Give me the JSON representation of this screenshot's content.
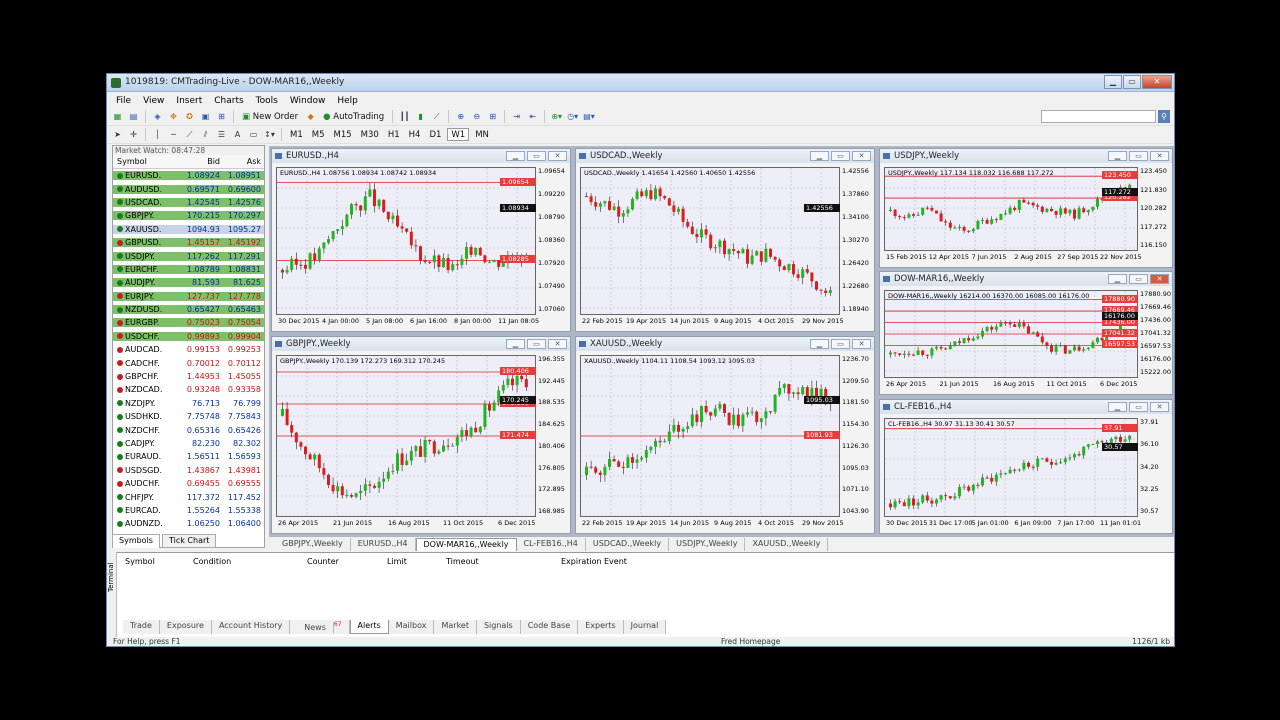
{
  "window": {
    "title": "1019819: CMTrading-Live - DOW-MAR16,,Weekly",
    "min": "▁",
    "max": "▭",
    "close": "✕"
  },
  "menu": [
    "File",
    "View",
    "Insert",
    "Charts",
    "Tools",
    "Window",
    "Help"
  ],
  "toolbar": {
    "new_order": "New Order",
    "autotrading": "AutoTrading",
    "timeframes": [
      "M1",
      "M5",
      "M15",
      "M30",
      "H1",
      "H4",
      "D1",
      "W1",
      "MN"
    ]
  },
  "market_watch": {
    "title": "Market Watch: 08:47:28",
    "headers": [
      "Symbol",
      "Bid",
      "Ask"
    ],
    "rows": [
      {
        "sym": "EURUSD.",
        "bid": "1.08924",
        "ask": "1.08951",
        "style": "g"
      },
      {
        "sym": "AUDUSD.",
        "bid": "0.69571",
        "ask": "0.69600",
        "style": "g"
      },
      {
        "sym": "USDCAD.",
        "bid": "1.42545",
        "ask": "1.42576",
        "style": "g"
      },
      {
        "sym": "GBPJPY.",
        "bid": "170.215",
        "ask": "170.297",
        "style": "g"
      },
      {
        "sym": "XAUUSD.",
        "bid": "1094.93",
        "ask": "1095.27",
        "style": "sel"
      },
      {
        "sym": "GBPUSD.",
        "bid": "1.45157",
        "ask": "1.45192",
        "style": "gr"
      },
      {
        "sym": "USDJPY.",
        "bid": "117.262",
        "ask": "117.291",
        "style": "g"
      },
      {
        "sym": "EURCHF.",
        "bid": "1.08789",
        "ask": "1.08831",
        "style": "g"
      },
      {
        "sym": "AUDJPY.",
        "bid": "81.593",
        "ask": "81.625",
        "style": "g"
      },
      {
        "sym": "EURJPY.",
        "bid": "127.737",
        "ask": "127.778",
        "style": "gr"
      },
      {
        "sym": "NZDUSD.",
        "bid": "0.65427",
        "ask": "0.65463",
        "style": "g"
      },
      {
        "sym": "EURGBP.",
        "bid": "0.75023",
        "ask": "0.75054",
        "style": "gr"
      },
      {
        "sym": "USDCHF.",
        "bid": "0.99893",
        "ask": "0.99904",
        "style": "gr"
      },
      {
        "sym": "AUDCAD.",
        "bid": "0.99153",
        "ask": "0.99253",
        "style": "w"
      },
      {
        "sym": "CADCHF.",
        "bid": "0.70012",
        "ask": "0.70112",
        "style": "w"
      },
      {
        "sym": "GBPCHF.",
        "bid": "1.44953",
        "ask": "1.45055",
        "style": "w"
      },
      {
        "sym": "NZDCAD.",
        "bid": "0.93248",
        "ask": "0.93358",
        "style": "w"
      },
      {
        "sym": "NZDJPY.",
        "bid": "76.713",
        "ask": "76.799",
        "style": "wb"
      },
      {
        "sym": "USDHKD.",
        "bid": "7.75748",
        "ask": "7.75843",
        "style": "wb"
      },
      {
        "sym": "NZDCHF.",
        "bid": "0.65316",
        "ask": "0.65426",
        "style": "wb"
      },
      {
        "sym": "CADJPY.",
        "bid": "82.230",
        "ask": "82.302",
        "style": "wb"
      },
      {
        "sym": "EURAUD.",
        "bid": "1.56511",
        "ask": "1.56593",
        "style": "wb"
      },
      {
        "sym": "USDSGD.",
        "bid": "1.43867",
        "ask": "1.43981",
        "style": "w"
      },
      {
        "sym": "AUDCHF.",
        "bid": "0.69455",
        "ask": "0.69555",
        "style": "w"
      },
      {
        "sym": "CHFJPY.",
        "bid": "117.372",
        "ask": "117.452",
        "style": "wb"
      },
      {
        "sym": "EURCAD.",
        "bid": "1.55264",
        "ask": "1.55338",
        "style": "wb"
      },
      {
        "sym": "AUDNZD.",
        "bid": "1.06250",
        "ask": "1.06400",
        "style": "wb"
      }
    ],
    "tabs": [
      "Symbols",
      "Tick Chart"
    ]
  },
  "charts": [
    {
      "title": "EURUSD.,H4",
      "info": "EURUSD.,H4  1.08756 1.08934 1.08742 1.08934",
      "prices": [
        "1.09654",
        "1.09220",
        "1.08790",
        "1.08360",
        "1.07920",
        "1.07490",
        "1.07060"
      ],
      "markers": [
        {
          "v": "1.09654",
          "c": "red"
        },
        {
          "v": "1.08934",
          "c": "blk"
        },
        {
          "v": "1.08285",
          "c": "red"
        }
      ],
      "dates": [
        "30 Dec 2015",
        "4 Jan 00:00",
        "5 Jan 08:00",
        "6 Jan 16:00",
        "8 Jan 00:00",
        "11 Jan 08:05"
      ]
    },
    {
      "title": "USDCAD.,Weekly",
      "info": "USDCAD.,Weekly  1.41654 1.42560 1.40650 1.42556",
      "prices": [
        "1.42556",
        "1.37860",
        "1.34100",
        "1.30270",
        "1.26420",
        "1.22680",
        "1.18940"
      ],
      "markers": [
        {
          "v": "1.42556",
          "c": "blk"
        }
      ],
      "dates": [
        "22 Feb 2015",
        "19 Apr 2015",
        "14 Jun 2015",
        "9 Aug 2015",
        "4 Oct 2015",
        "29 Nov 2015"
      ]
    },
    {
      "title": "USDJPY.,Weekly",
      "info": "USDJPY.,Weekly  117.134 118.032 116.688 117.272",
      "prices": [
        "123.450",
        "121.830",
        "120.282",
        "117.272",
        "116.150"
      ],
      "markers": [
        {
          "v": "123.450",
          "c": "red"
        },
        {
          "v": "120.282",
          "c": "red"
        },
        {
          "v": "117.272",
          "c": "blk"
        }
      ],
      "dates": [
        "15 Feb 2015",
        "12 Apr 2015",
        "7 Jun 2015",
        "2 Aug 2015",
        "27 Sep 2015",
        "22 Nov 2015"
      ]
    },
    {
      "title": "DOW-MAR16,,Weekly",
      "info": "DOW-MAR16,,Weekly  16214.00 16370.00 16085.00 16176.00",
      "prices": [
        "17880.90",
        "17669.46",
        "17436.00",
        "17041.32",
        "16597.53",
        "16176.00",
        "15222.00"
      ],
      "markers": [
        {
          "v": "17880.90",
          "c": "red"
        },
        {
          "v": "17669.46",
          "c": "red"
        },
        {
          "v": "17436.00",
          "c": "red"
        },
        {
          "v": "17041.32",
          "c": "red"
        },
        {
          "v": "16597.53",
          "c": "red"
        },
        {
          "v": "16176.00",
          "c": "blk"
        }
      ],
      "dates": [
        "26 Apr 2015",
        "21 Jun 2015",
        "16 Aug 2015",
        "11 Oct 2015",
        "6 Dec 2015"
      ]
    },
    {
      "title": "GBPJPY.,Weekly",
      "info": "GBPJPY.,Weekly  170.139 172.273 169.312 170.245",
      "prices": [
        "196.355",
        "192.445",
        "188.535",
        "184.625",
        "180.406",
        "176.805",
        "172.895",
        "168.985"
      ],
      "markers": [
        {
          "v": "180.406",
          "c": "red"
        },
        {
          "v": "175.530",
          "c": "red"
        },
        {
          "v": "171.474",
          "c": "red"
        },
        {
          "v": "170.245",
          "c": "blk"
        }
      ],
      "dates": [
        "26 Apr 2015",
        "21 Jun 2015",
        "16 Aug 2015",
        "11 Oct 2015",
        "6 Dec 2015"
      ]
    },
    {
      "title": "XAUUSD.,Weekly",
      "info": "XAUUSD.,Weekly  1104.11 1108.54 1093.12 1095.03",
      "prices": [
        "1236.70",
        "1209.50",
        "1181.50",
        "1154.30",
        "1126.30",
        "1095.03",
        "1071.10",
        "1043.90"
      ],
      "markers": [
        {
          "v": "1095.03",
          "c": "blk"
        },
        {
          "v": "1081.93",
          "c": "red"
        }
      ],
      "dates": [
        "22 Feb 2015",
        "19 Apr 2015",
        "14 Jun 2015",
        "9 Aug 2015",
        "4 Oct 2015",
        "29 Nov 2015"
      ]
    },
    {
      "title": "CL-FEB16.,H4",
      "info": "CL-FEB16.,H4  30.97 31.13 30.41 30.57",
      "prices": [
        "37.91",
        "36.10",
        "34.20",
        "32.25",
        "30.57"
      ],
      "markers": [
        {
          "v": "37.91",
          "c": "red"
        },
        {
          "v": "30.57",
          "c": "blk"
        }
      ],
      "dates": [
        "30 Dec 2015",
        "31 Dec 17:00",
        "5 Jan 01:00",
        "6 Jan 09:00",
        "7 Jan 17:00",
        "11 Jan 01:01"
      ]
    }
  ],
  "chart_tabs": [
    "GBPJPY.,Weekly",
    "EURUSD.,H4",
    "DOW-MAR16,,Weekly",
    "CL-FEB16.,H4",
    "USDCAD.,Weekly",
    "USDJPY.,Weekly",
    "XAUUSD.,Weekly"
  ],
  "terminal": {
    "label": "Terminal",
    "headers": [
      "Symbol",
      "Condition",
      "Counter",
      "Limit",
      "Timeout",
      "Expiration",
      "Event"
    ],
    "tabs": [
      "Trade",
      "Exposure",
      "Account History",
      "News",
      "Alerts",
      "Mailbox",
      "Market",
      "Signals",
      "Code Base",
      "Experts",
      "Journal"
    ],
    "news_badge": "67"
  },
  "status": {
    "help": "For Help, press F1",
    "profile": "Fred Homepage",
    "traffic": "1126/1 kb"
  }
}
